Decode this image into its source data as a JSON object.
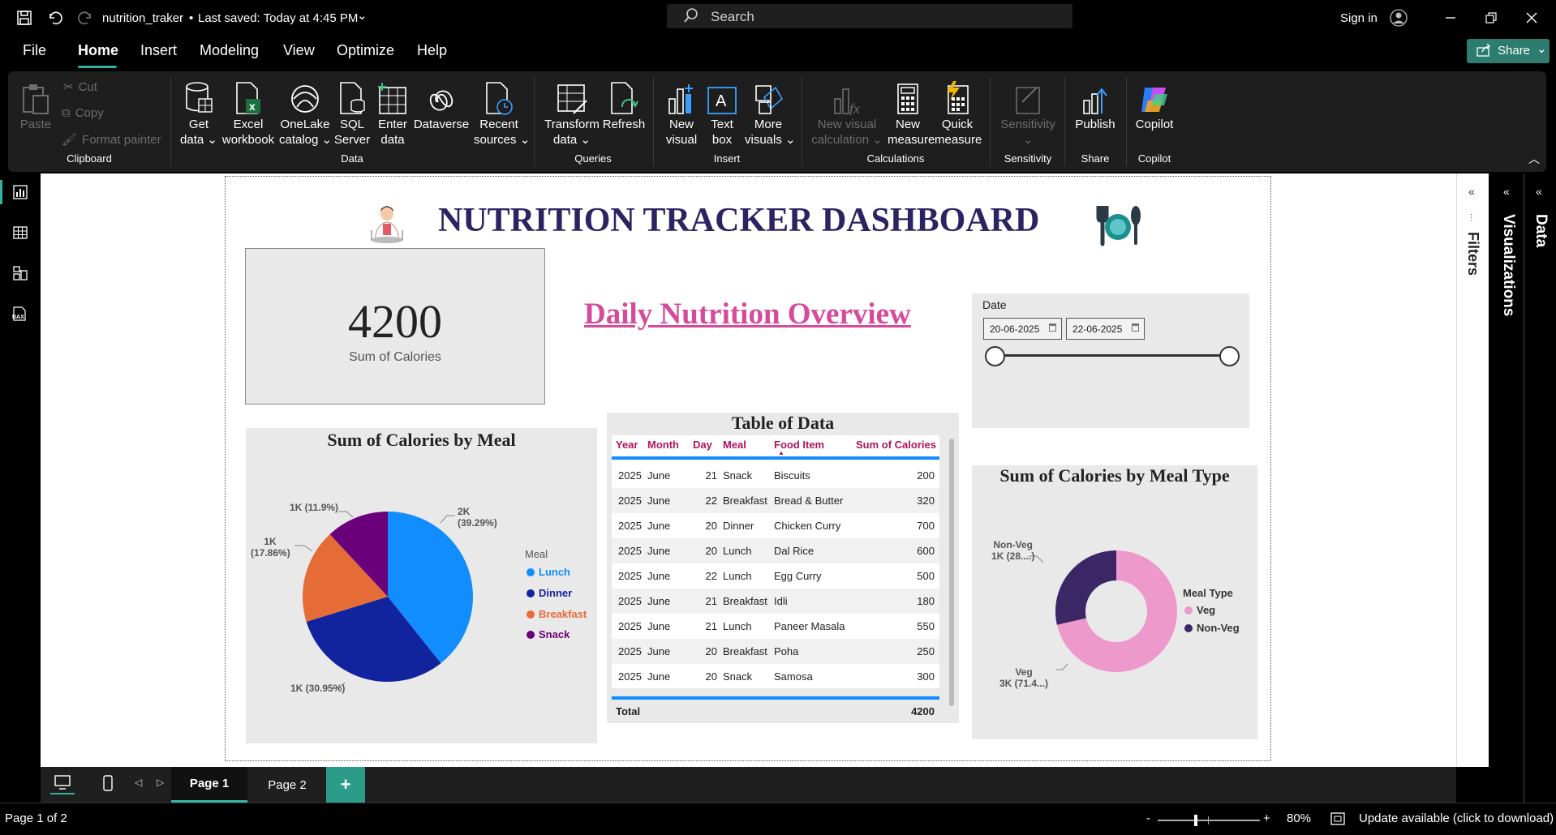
{
  "titlebar": {
    "file_name": "nutrition_traker",
    "saved": "Last saved: Today at 4:45 PM",
    "search_placeholder": "Search",
    "sign_in": "Sign in"
  },
  "menu": {
    "items": [
      "File",
      "Home",
      "Insert",
      "Modeling",
      "View",
      "Optimize",
      "Help"
    ],
    "active": "Home",
    "share": "Share"
  },
  "ribbon": {
    "clipboard": {
      "paste": "Paste",
      "cut": "Cut",
      "copy": "Copy",
      "format_painter": "Format painter",
      "group": "Clipboard"
    },
    "data": {
      "get_data": [
        "Get",
        "data ⌄"
      ],
      "excel": [
        "Excel",
        "workbook"
      ],
      "onelake": [
        "OneLake",
        "catalog ⌄"
      ],
      "sql": [
        "SQL",
        "Server"
      ],
      "enter": [
        "Enter",
        "data"
      ],
      "dataverse": "Dataverse",
      "recent": [
        "Recent",
        "sources ⌄"
      ],
      "group": "Data"
    },
    "queries": {
      "transform": [
        "Transform",
        "data ⌄"
      ],
      "refresh": "Refresh",
      "group": "Queries"
    },
    "insert": {
      "new_visual": [
        "New",
        "visual"
      ],
      "text_box": [
        "Text",
        "box"
      ],
      "more_visuals": [
        "More",
        "visuals ⌄"
      ],
      "group": "Insert"
    },
    "calculations": {
      "new_visual_calc": [
        "New visual",
        "calculation ⌄"
      ],
      "new_measure": [
        "New",
        "measure"
      ],
      "quick_measure": [
        "Quick",
        "measure"
      ],
      "group": "Calculations"
    },
    "sensitivity": {
      "label": "Sensitivity",
      "group": "Sensitivity"
    },
    "share": {
      "publish": "Publish",
      "group": "Share"
    },
    "copilot": {
      "label": "Copilot",
      "group": "Copilot"
    }
  },
  "panes": {
    "filters": "Filters",
    "visualizations": "Visualizations",
    "data": "Data"
  },
  "dashboard": {
    "title": "NUTRITION TRACKER DASHBOARD",
    "kpi": {
      "value": "4200",
      "label": "Sum of Calories"
    },
    "overview_heading": "Daily Nutrition Overview",
    "date_slicer": {
      "title": "Date",
      "start": "20-06-2025",
      "end": "22-06-2025"
    }
  },
  "table": {
    "title": "Table of Data",
    "columns": [
      "Year",
      "Month",
      "Day",
      "Meal",
      "Food Item",
      "Sum of Calories"
    ],
    "rows": [
      [
        "2025",
        "June",
        "21",
        "Snack",
        "Biscuits",
        "200"
      ],
      [
        "2025",
        "June",
        "22",
        "Breakfast",
        "Bread & Butter",
        "320"
      ],
      [
        "2025",
        "June",
        "20",
        "Dinner",
        "Chicken Curry",
        "700"
      ],
      [
        "2025",
        "June",
        "20",
        "Lunch",
        "Dal Rice",
        "600"
      ],
      [
        "2025",
        "June",
        "22",
        "Lunch",
        "Egg Curry",
        "500"
      ],
      [
        "2025",
        "June",
        "21",
        "Breakfast",
        "Idli",
        "180"
      ],
      [
        "2025",
        "June",
        "21",
        "Lunch",
        "Paneer Masala",
        "550"
      ],
      [
        "2025",
        "June",
        "20",
        "Breakfast",
        "Poha",
        "250"
      ],
      [
        "2025",
        "June",
        "20",
        "Snack",
        "Samosa",
        "300"
      ]
    ],
    "total_label": "Total",
    "total_value": "4200"
  },
  "chart_data": [
    {
      "type": "pie",
      "title": "Sum of Calories by Meal",
      "legend_title": "Meal",
      "legend_position": "right",
      "categories": [
        "Lunch",
        "Dinner",
        "Breakfast",
        "Snack"
      ],
      "values": [
        1650,
        1300,
        750,
        500
      ],
      "colors": [
        "#118dff",
        "#12239e",
        "#e66c37",
        "#6b007b"
      ],
      "labels": [
        [
          "2K",
          "(39.29%)"
        ],
        [
          "1K (30.95%)"
        ],
        [
          "1K",
          "(17.86%)"
        ],
        [
          "1K (11.9%)"
        ]
      ]
    },
    {
      "type": "pie",
      "title": "Sum of Calories by Meal Type",
      "legend_title": "Meal Type",
      "legend_position": "right",
      "categories": [
        "Veg",
        "Non-Veg"
      ],
      "values": [
        3000,
        1200
      ],
      "colors": [
        "#ee99cc",
        "#3b2766"
      ],
      "labels": [
        [
          "Veg",
          "3K (71.4...)"
        ],
        [
          "Non-Veg",
          "1K (28....)"
        ]
      ]
    }
  ],
  "pages": {
    "tabs": [
      "Page 1",
      "Page 2"
    ],
    "active": "Page 1",
    "add": "+"
  },
  "status": {
    "page": "Page 1 of 2",
    "zoom": "80%",
    "zoom_minus": "-",
    "zoom_plus": "+",
    "update": "Update available (click to download)"
  }
}
